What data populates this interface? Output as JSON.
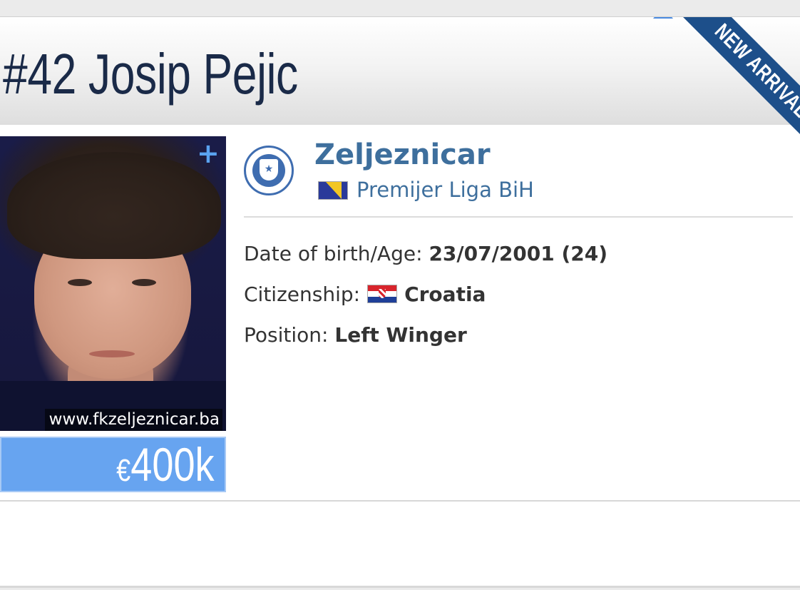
{
  "player": {
    "name": "#42 Josip Pejic",
    "badge": "NEW ARRIVAL",
    "photo_credit": "www.fkzeljeznicar.ba",
    "market_value_currency": "€",
    "market_value_amount": "400k"
  },
  "club": {
    "name": "Zeljeznicar",
    "league": "Premijer Liga BiH",
    "league_flag_icon": "bosnia-herzegovina-flag-icon"
  },
  "details": {
    "dob_label": "Date of birth/Age:",
    "dob_value": "23/07/2001 (24)",
    "citizenship_label": "Citizenship:",
    "citizenship_value": "Croatia",
    "citizenship_flag_icon": "croatia-flag-icon",
    "position_label": "Position:",
    "position_value": "Left Winger"
  },
  "colors": {
    "name_text": "#1a2a48",
    "club_link": "#3e6f9d",
    "ribbon": "#1d4f8a",
    "market_value_bg": "#67a4f0"
  }
}
